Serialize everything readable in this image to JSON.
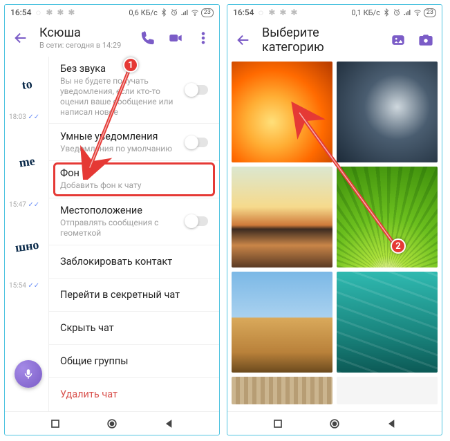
{
  "status": {
    "time": "16:54",
    "net_left": "0,6 КБ/с",
    "net_right": "0,1 КБ/с",
    "battery": "23"
  },
  "left": {
    "contact_name": "Ксюша",
    "last_seen": "В сети: сегодня в 14:29",
    "peek_times": [
      "18:03",
      "15:47",
      "15:54"
    ],
    "stickers": [
      "to",
      "me",
      "шно"
    ],
    "settings": {
      "mute": {
        "title": "Без звука",
        "sub": "Вы не будете получать уведомления, если кто-то оценил ваше сообщение или написал новое"
      },
      "smart": {
        "title": "Умные уведомления",
        "sub": "Уведомления по умолчанию"
      },
      "bg": {
        "title": "Фон",
        "sub": "Добавить фон к чату"
      },
      "location": {
        "title": "Местоположение",
        "sub": "Отправлять сообщения с геометкой"
      },
      "block": {
        "title": "Заблокировать контакт"
      },
      "secret": {
        "title": "Перейти в секретный чат"
      },
      "hide": {
        "title": "Скрыть чат"
      },
      "groups": {
        "title": "Общие группы"
      },
      "delete": {
        "title": "Удалить чат"
      }
    }
  },
  "right": {
    "title": "Выберите категорию"
  },
  "callouts": {
    "one": "1",
    "two": "2"
  }
}
